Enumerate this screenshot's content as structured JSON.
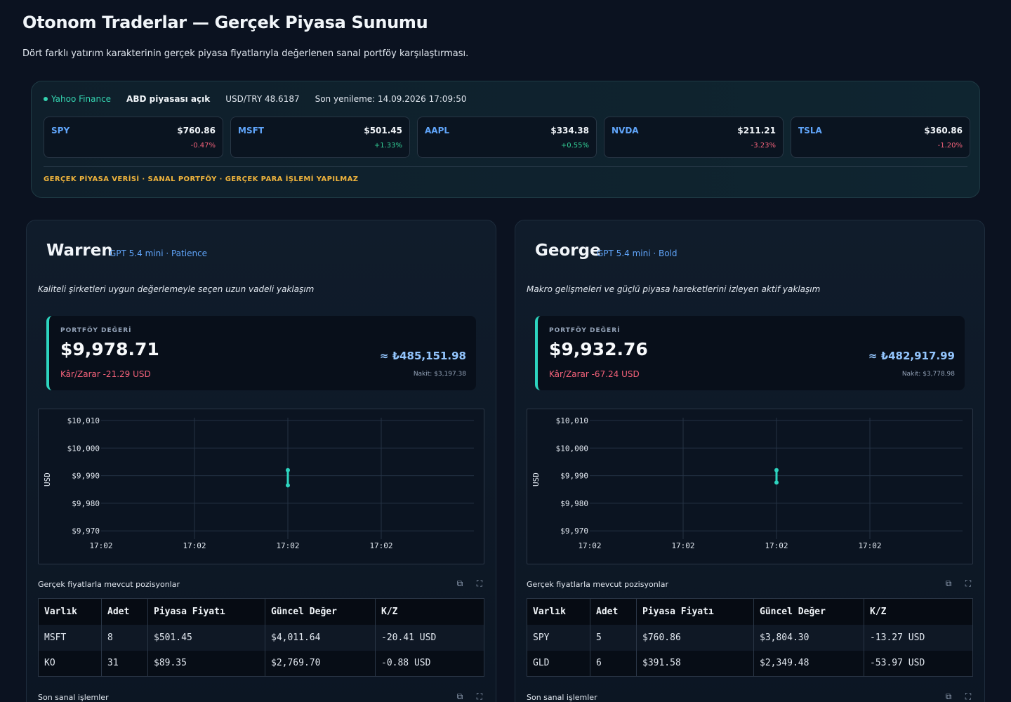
{
  "header": {
    "title": "Otonom Traderlar — Gerçek Piyasa Sunumu",
    "subtitle": "Dört farklı yatırım karakterinin gerçek piyasa fiyatlarıyla değerlenen sanal portföy karşılaştırması."
  },
  "market": {
    "source": "Yahoo Finance",
    "market_status": "ABD piyasası açık",
    "fx": "USD/TRY 48.6187",
    "refresh": "Son yenileme: 14.09.2026 17:09:50",
    "tickers": [
      {
        "symbol": "SPY",
        "price": "$760.86",
        "change": "-0.47%"
      },
      {
        "symbol": "MSFT",
        "price": "$501.45",
        "change": "+1.33%"
      },
      {
        "symbol": "AAPL",
        "price": "$334.38",
        "change": "+0.55%"
      },
      {
        "symbol": "NVDA",
        "price": "$211.21",
        "change": "-3.23%"
      },
      {
        "symbol": "TSLA",
        "price": "$360.86",
        "change": "-1.20%"
      }
    ],
    "disclaimer": "GERÇEK PİYASA VERİSİ · SANAL PORTFÖY · GERÇEK PARA İŞLEMİ YAPILMAZ"
  },
  "labels": {
    "portfolio_value": "PORTFÖY DEĞERİ",
    "positions_title": "Gerçek fiyatlarla mevcut pozisyonlar",
    "trades_title": "Son sanal işlemler",
    "columns": [
      "Varlık",
      "Adet",
      "Piyasa Fiyatı",
      "Güncel Değer",
      "K/Z"
    ]
  },
  "traders": [
    {
      "name": "Warren",
      "model": "GPT 5.4 mini · Patience",
      "description": "Kaliteli şirketleri uygun değerlemeyle seçen uzun vadeli yaklaşım",
      "value": "$9,978.71",
      "pnl": "Kâr/Zarar -21.29 USD",
      "value_try": "≈ ₺485,151.98",
      "cash": "Nakit: $3,197.38",
      "positions": [
        [
          "MSFT",
          "8",
          "$501.45",
          "$4,011.64",
          "-20.41 USD"
        ],
        [
          "KO",
          "31",
          "$89.35",
          "$2,769.70",
          "-0.88 USD"
        ]
      ]
    },
    {
      "name": "George",
      "model": "GPT 5.4 mini · Bold",
      "description": "Makro gelişmeleri ve güçlü piyasa hareketlerini izleyen aktif yaklaşım",
      "value": "$9,932.76",
      "pnl": "Kâr/Zarar -67.24 USD",
      "value_try": "≈ ₺482,917.99",
      "cash": "Nakit: $3,778.98",
      "positions": [
        [
          "SPY",
          "5",
          "$760.86",
          "$3,804.30",
          "-13.27 USD"
        ],
        [
          "GLD",
          "6",
          "$391.58",
          "$2,349.48",
          "-53.97 USD"
        ]
      ]
    }
  ],
  "chart_data": [
    {
      "type": "line",
      "ylabel": "USD",
      "yticks": [
        "$9,970",
        "$9,980",
        "$9,990",
        "$10,000",
        "$10,010"
      ],
      "xticks": [
        "17:02",
        "17:02",
        "17:02",
        "17:02"
      ],
      "ylim": [
        9967,
        10011
      ],
      "series": [
        {
          "points": [
            {
              "x": 2,
              "y": 9992
            },
            {
              "x": 2,
              "y": 9986.5
            }
          ]
        }
      ],
      "color": "#2dd4bf"
    },
    {
      "type": "line",
      "ylabel": "USD",
      "yticks": [
        "$9,970",
        "$9,980",
        "$9,990",
        "$10,000",
        "$10,010"
      ],
      "xticks": [
        "17:02",
        "17:02",
        "17:02",
        "17:02"
      ],
      "ylim": [
        9967,
        10011
      ],
      "series": [
        {
          "points": [
            {
              "x": 2,
              "y": 9992
            },
            {
              "x": 2,
              "y": 9987.5
            }
          ]
        }
      ],
      "color": "#2dd4bf"
    }
  ]
}
